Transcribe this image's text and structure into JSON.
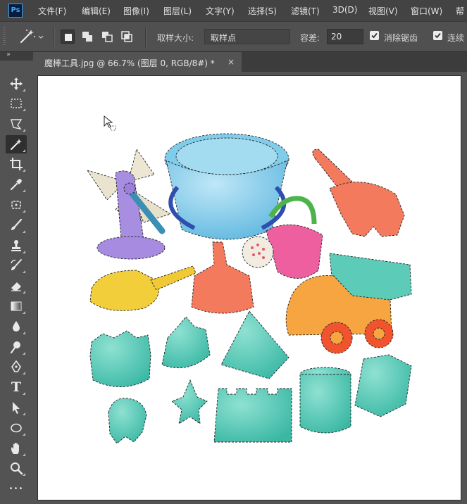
{
  "app": {
    "logo_text": "Ps"
  },
  "menu": [
    "文件(F)",
    "编辑(E)",
    "图像(I)",
    "图层(L)",
    "文字(Y)",
    "选择(S)",
    "滤镜(T)",
    "3D(D)",
    "视图(V)",
    "窗口(W)",
    "帮"
  ],
  "options": {
    "sample_size_label": "取样大小:",
    "sample_size_value": "取样点",
    "tolerance_label": "容差:",
    "tolerance_value": "20",
    "antialias_label": "消除锯齿",
    "antialias_checked": true,
    "contiguous_label": "连续",
    "contiguous_checked": true
  },
  "document": {
    "tab_title": "魔棒工具.jpg @ 66.7% (图层 0, RGB/8#) *",
    "close_glyph": "×"
  },
  "toolbox": {
    "collapse_glyph": "››",
    "tools": [
      "move-tool",
      "marquee-tool",
      "lasso-tool",
      "magic-wand-tool",
      "crop-tool",
      "eyedropper-tool",
      "healing-tool",
      "brush-tool",
      "stamp-tool",
      "history-brush-tool",
      "eraser-tool",
      "gradient-tool",
      "blur-tool",
      "dodge-tool",
      "pen-tool",
      "type-tool",
      "path-select-tool",
      "shape-tool",
      "hand-tool",
      "zoom-tool",
      "more-tools"
    ],
    "active_tool": "magic-wand-tool",
    "type_tool_glyph": "T",
    "more_glyph": "•••"
  },
  "colors": {
    "ui_dark": "#434343",
    "panel": "#535353",
    "canvas": "#ffffff",
    "accent": "#31a8ff",
    "toy_teal": "#4fc7b4",
    "bucket_blue": "#6fc3e6",
    "coral": "#f47a5d",
    "yellow": "#f2cf3a",
    "purple": "#a88ee0",
    "orange": "#f49a35",
    "pink": "#ef5f9e"
  }
}
